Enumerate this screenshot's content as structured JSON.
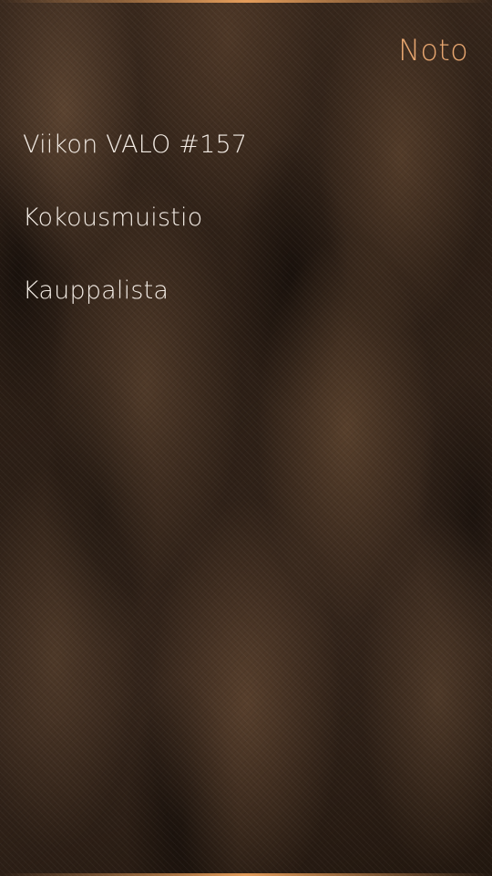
{
  "app": {
    "page_title": "Noto"
  },
  "notes": [
    {
      "title": "Viikon VALO #157"
    },
    {
      "title": "Kokousmuistio"
    },
    {
      "title": "Kauppalista"
    }
  ],
  "colors": {
    "accent": "#e6a56f",
    "primary_text": "#f2ebe4",
    "background": "#2b1e15"
  }
}
